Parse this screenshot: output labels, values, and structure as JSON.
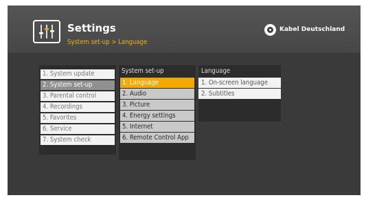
{
  "header": {
    "title": "Settings",
    "breadcrumb": "System set-up > Language",
    "brand": "Kabel Deutschland",
    "accent_color": "#f2a900",
    "icon": "settings-sliders-icon"
  },
  "main_menu": {
    "items": [
      "1. System update",
      "2. System set-up",
      "3. Parental control",
      "4. Recordings",
      "5. Favorites",
      "6. Service",
      "7. System check"
    ],
    "selected_index": 1
  },
  "setup_menu": {
    "title": "System set-up",
    "items": [
      "1. Language",
      "2. Audio",
      "3. Picture",
      "4. Energy settings",
      "5. Internet",
      "6. Remote Control App"
    ],
    "selected_index": 0
  },
  "language_menu": {
    "title": "Language",
    "items": [
      "1. On-screen language",
      "2. Subtitles"
    ]
  }
}
